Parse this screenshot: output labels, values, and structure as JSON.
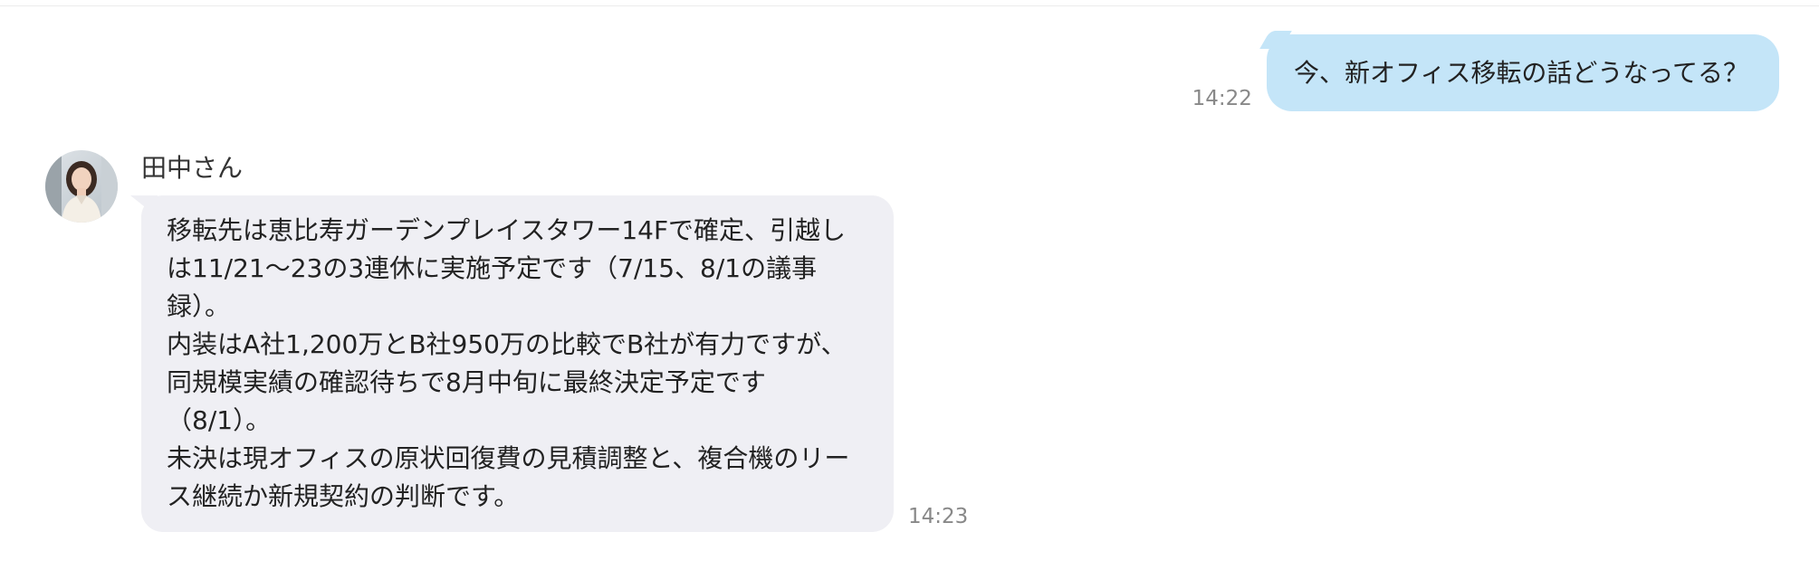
{
  "chat": {
    "outgoing": {
      "text": "今、新オフィス移転の話どうなってる？",
      "time": "14:22"
    },
    "incoming": {
      "sender": "田中さん",
      "lines": [
        "移転先は恵比寿ガーデンプレイスタワー14Fで確定、引越し",
        "は11/21〜23の3連休に実施予定です（7/15、8/1の議事",
        "録）。",
        "内装はA社1,200万とB社950万の比較でB社が有力ですが、",
        "同規模実績の確認待ちで8月中旬に最終決定予定です",
        "（8/1）。",
        "未決は現オフィスの原状回復費の見積調整と、複合機のリー",
        "ス継続か新規契約の判断です。"
      ],
      "time": "14:23"
    }
  },
  "colors": {
    "outgoing_bubble": "#c4e5f8",
    "incoming_bubble": "#efeff4",
    "timestamp": "#888888"
  },
  "icons": {
    "avatar": "person-photo-avatar"
  }
}
